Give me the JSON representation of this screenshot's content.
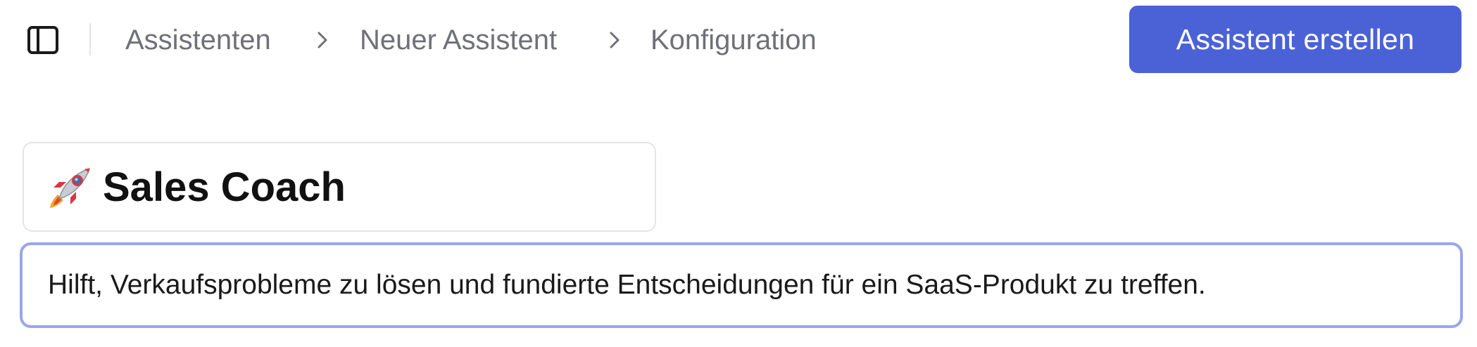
{
  "header": {
    "sidebar_toggle_icon": "sidebar-panel-icon",
    "breadcrumb": [
      {
        "label": "Assistenten"
      },
      {
        "label": "Neuer Assistent"
      },
      {
        "label": "Konfiguration"
      }
    ],
    "separator_icon": "chevron-right-icon",
    "create_button_label": "Assistent erstellen",
    "accent_color": "#4b62d6"
  },
  "assistant": {
    "icon": "rocket-icon",
    "name": "Sales Coach",
    "description": "Hilft, Verkaufsprobleme zu lösen und fundierte Entscheidungen für ein SaaS-Produkt zu treffen.",
    "focus_border_color": "#9aa6ea"
  }
}
